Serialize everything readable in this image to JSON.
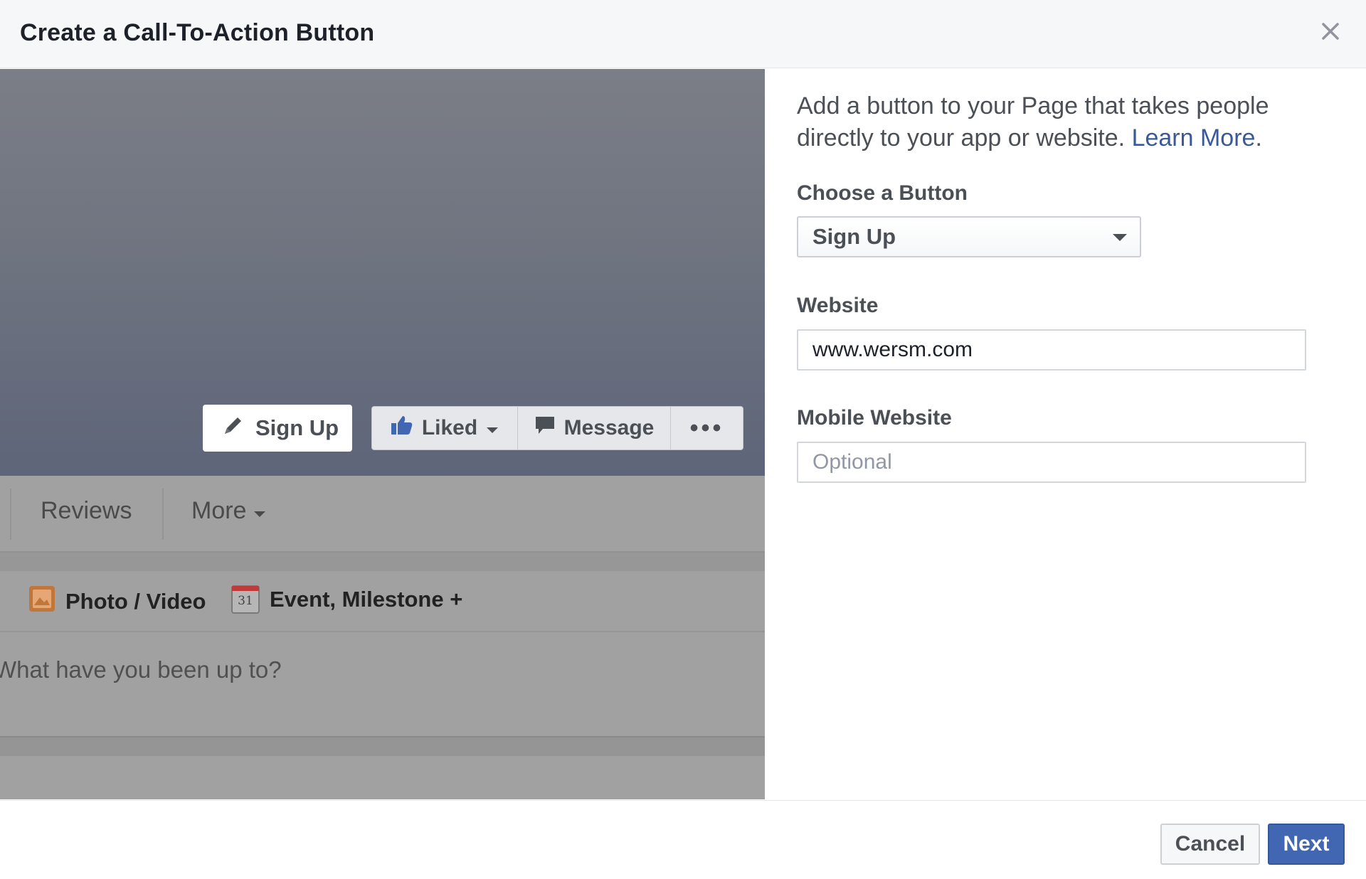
{
  "dialog": {
    "title": "Create a Call-To-Action Button",
    "close_icon": "close-icon"
  },
  "preview": {
    "cta_button": {
      "label": "Sign Up",
      "icon": "pencil-icon"
    },
    "liked_button": {
      "label": "Liked",
      "icon": "thumbs-up-icon"
    },
    "message_button": {
      "label": "Message",
      "icon": "chat-bubble-icon"
    },
    "more_actions": "•••",
    "tabs": {
      "reviews": "Reviews",
      "more": "More"
    },
    "composer": {
      "photo_video": "Photo / Video",
      "event_milestone": "Event, Milestone +",
      "calendar_day": "31",
      "prompt": "What have you been up to?"
    }
  },
  "form": {
    "description": "Add a button to your Page that takes people directly to your app or website.",
    "learn_more": "Learn More",
    "period": ".",
    "choose_label": "Choose a Button",
    "choose_value": "Sign Up",
    "website_label": "Website",
    "website_value": "www.wersm.com",
    "mobile_label": "Mobile Website",
    "mobile_placeholder": "Optional"
  },
  "footer": {
    "cancel": "Cancel",
    "next": "Next"
  },
  "colors": {
    "accent": "#4267b2",
    "link": "#3b5998",
    "header_bg": "#f6f7f9"
  }
}
